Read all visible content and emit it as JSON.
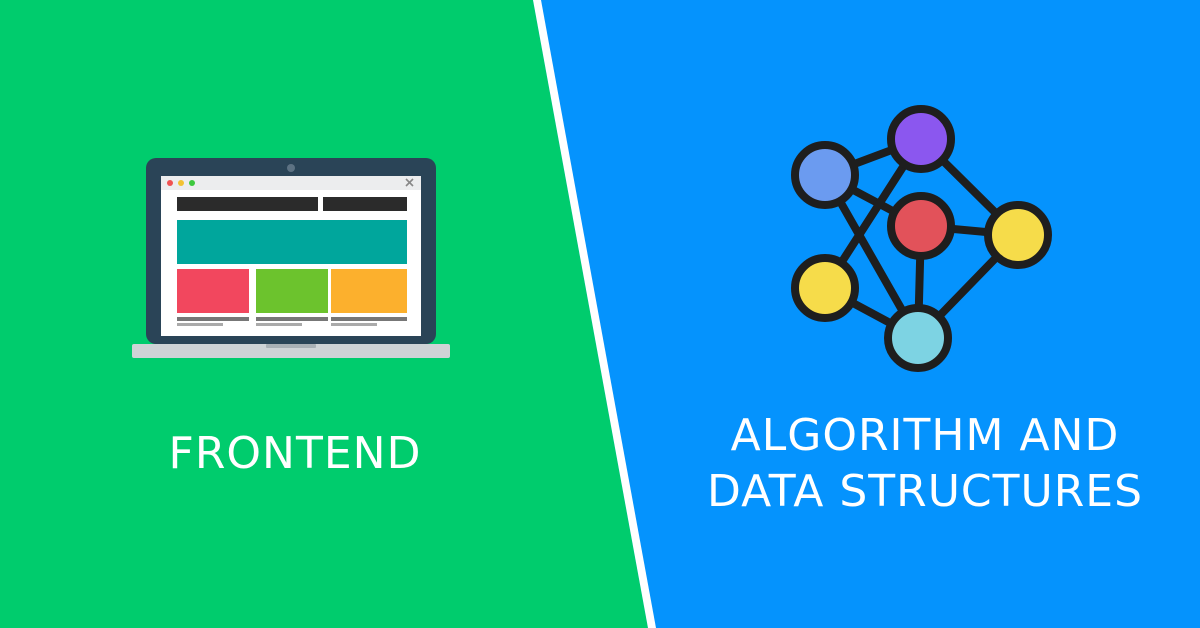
{
  "colors": {
    "left_background": "#00cc6d",
    "right_background": "#0593fd",
    "divider": "#ffffff",
    "text": "#ffffff",
    "laptop_bezel": "#2a4457",
    "laptop_base": "#cfd3d6",
    "node_outline": "#1e1e1e",
    "node_blue": "#6b9bf0",
    "node_purple": "#8b57ef",
    "node_red": "#e2525a",
    "node_yellow": "#f6dc4a",
    "node_cyan": "#7dd3e3"
  },
  "left": {
    "title": "FRONTEND",
    "icon": "laptop-webpage-icon"
  },
  "right": {
    "title_line1": "ALGORITHM AND",
    "title_line2": "DATA STRUCTURES",
    "icon": "graph-network-icon"
  }
}
